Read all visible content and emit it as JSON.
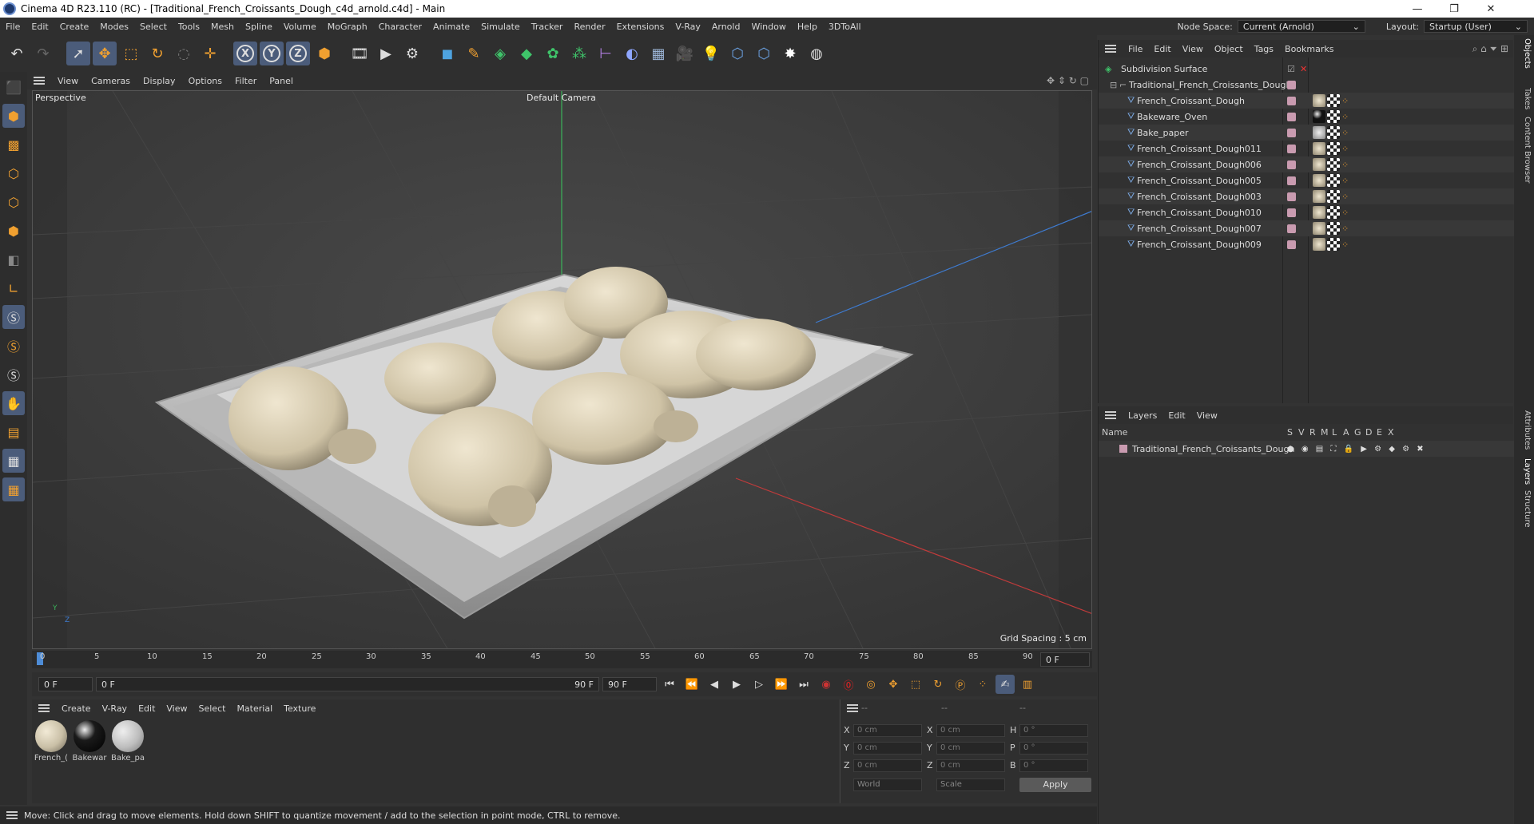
{
  "window": {
    "title": "Cinema 4D R23.110 (RC) - [Traditional_French_Croissants_Dough_c4d_arnold.c4d] - Main",
    "controls": [
      "—",
      "❐",
      "✕"
    ]
  },
  "menubar": {
    "items": [
      "File",
      "Edit",
      "Create",
      "Modes",
      "Select",
      "Tools",
      "Mesh",
      "Spline",
      "Volume",
      "MoGraph",
      "Character",
      "Animate",
      "Simulate",
      "Tracker",
      "Render",
      "Extensions",
      "V-Ray",
      "Arnold",
      "Window",
      "Help",
      "3DToAll"
    ],
    "node_space_label": "Node Space:",
    "node_space_value": "Current (Arnold)",
    "layout_label": "Layout:",
    "layout_value": "Startup (User)"
  },
  "toolbar": {
    "icons": [
      "undo-icon",
      "redo-icon",
      "select-icon",
      "move-icon",
      "scale-icon",
      "rotate-icon",
      "live-select-icon",
      "add-icon",
      "x-axis-icon",
      "y-axis-icon",
      "z-axis-icon",
      "world-coord-icon",
      "render-view-icon",
      "render-icon",
      "render-settings-icon",
      "cube-icon",
      "pen-icon",
      "subdivision-icon",
      "extrude-icon",
      "cloner-icon",
      "array-icon",
      "symmetry-icon",
      "deformer-icon",
      "floor-icon",
      "camera-icon",
      "light-icon",
      "python-icon",
      "python2-icon",
      "gear-icon",
      "sphere-grid-icon"
    ],
    "axis_labels": [
      "X",
      "Y",
      "Z"
    ]
  },
  "viewport": {
    "menu": [
      "View",
      "Cameras",
      "Display",
      "Options",
      "Filter",
      "Panel"
    ],
    "mode_label": "Perspective",
    "camera_label": "Default Camera",
    "grid_spacing": "Grid Spacing : 5 cm",
    "axis_y": "Y",
    "axis_z": "Z"
  },
  "timeline": {
    "ticks": [
      "0",
      "5",
      "10",
      "15",
      "20",
      "25",
      "30",
      "35",
      "40",
      "45",
      "50",
      "55",
      "60",
      "65",
      "70",
      "75",
      "80",
      "85",
      "90"
    ],
    "current_frame": "0 F"
  },
  "transport": {
    "start_field": "0 F",
    "range_start": "0 F",
    "range_end": "90 F",
    "end_field": "90 F"
  },
  "material_panel": {
    "menu": [
      "Create",
      "V-Ray",
      "Edit",
      "View",
      "Select",
      "Material",
      "Texture"
    ],
    "materials": [
      {
        "name": "French_(",
        "color": "#c9bfa6"
      },
      {
        "name": "Bakewar",
        "color": "#1a1a1a"
      },
      {
        "name": "Bake_pa",
        "color": "#bdbdbd"
      }
    ]
  },
  "coordinates": {
    "headers": [
      "--",
      "--",
      "--"
    ],
    "rows": [
      {
        "a": "X",
        "av": "0 cm",
        "b": "X",
        "bv": "0 cm",
        "c": "H",
        "cv": "0 °"
      },
      {
        "a": "Y",
        "av": "0 cm",
        "b": "Y",
        "bv": "0 cm",
        "c": "P",
        "cv": "0 °"
      },
      {
        "a": "Z",
        "av": "0 cm",
        "b": "Z",
        "bv": "0 cm",
        "c": "B",
        "cv": "0 °"
      }
    ],
    "space": "World",
    "mode": "Scale",
    "apply": "Apply"
  },
  "status": {
    "text": "Move: Click and drag to move elements. Hold down SHIFT to quantize movement / add to the selection in point mode, CTRL to remove."
  },
  "objects_panel": {
    "menu": [
      "File",
      "Edit",
      "View",
      "Object",
      "Tags",
      "Bookmarks"
    ],
    "items": [
      {
        "name": "Subdivision Surface",
        "indent": 0
      },
      {
        "name": "Traditional_French_Croissants_Dough",
        "indent": 1
      },
      {
        "name": "French_Croissant_Dough",
        "indent": 2
      },
      {
        "name": "Bakeware_Oven",
        "indent": 2
      },
      {
        "name": "Bake_paper",
        "indent": 2
      },
      {
        "name": "French_Croissant_Dough011",
        "indent": 2
      },
      {
        "name": "French_Croissant_Dough006",
        "indent": 2
      },
      {
        "name": "French_Croissant_Dough005",
        "indent": 2
      },
      {
        "name": "French_Croissant_Dough003",
        "indent": 2
      },
      {
        "name": "French_Croissant_Dough010",
        "indent": 2
      },
      {
        "name": "French_Croissant_Dough007",
        "indent": 2
      },
      {
        "name": "French_Croissant_Dough009",
        "indent": 2
      }
    ]
  },
  "layers_panel": {
    "menu": [
      "Layers",
      "Edit",
      "View"
    ],
    "columns": [
      "Name",
      "S",
      "V",
      "R",
      "M",
      "L",
      "A",
      "G",
      "D",
      "E",
      "X"
    ],
    "layers": [
      {
        "name": "Traditional_French_Croissants_Dough"
      }
    ]
  },
  "side_tabs": [
    "Objects",
    "Takes",
    "Content Browser",
    "Attributes",
    "Layers",
    "Structure"
  ]
}
